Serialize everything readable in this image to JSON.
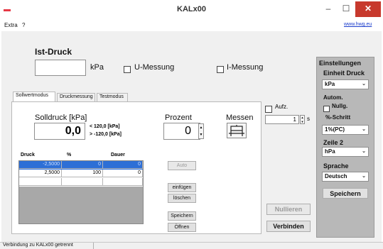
{
  "window": {
    "title": "KALx00",
    "min_glyph": "–",
    "max_glyph": "☐",
    "close_glyph": "✕"
  },
  "menu": {
    "items": [
      "Extra",
      "?"
    ],
    "link": "www.hwg.eu"
  },
  "ist_druck": {
    "title": "Ist-Druck",
    "value": "",
    "unit": "kPa",
    "u_messung": "U-Messung",
    "i_messung": "I-Messung"
  },
  "tabs": [
    "Sollwertmodus",
    "Druckmessung",
    "Testmodus"
  ],
  "solldruck": {
    "label": "Solldruck [kPa]",
    "value": "0,0",
    "max_label": "< 120,0 [kPa]",
    "min_label": "> -120,0 [kPa]"
  },
  "prozent": {
    "label": "Prozent",
    "value": "0"
  },
  "messen": {
    "label": "Messen"
  },
  "aufz": {
    "label": "Aufz.",
    "value": "1",
    "unit": "s"
  },
  "table": {
    "headers": [
      "Druck",
      "%",
      "Dauer"
    ],
    "rows": [
      [
        "-2,5000",
        "0",
        "0"
      ],
      [
        "2,5000",
        "100",
        "0"
      ],
      [
        "",
        "",
        ""
      ]
    ]
  },
  "buttons": {
    "auto": "Auto",
    "einfuegen": "einfügen",
    "loeschen": "löschen",
    "speichern": "Speichern",
    "oeffnen": "Öffnen",
    "nullieren": "Nullieren",
    "verbinden": "Verbinden"
  },
  "settings": {
    "title": "Einstellungen",
    "einheit_label": "Einheit Druck",
    "einheit_value": "kPa",
    "autom_label": "Autom.",
    "nullg_label": "Nullg.",
    "schritt_label": "%-Schritt",
    "schritt_value": "1%(PC)",
    "zeile_label": "Zeile 2",
    "zeile_value": "hPa",
    "sprache_label": "Sprache",
    "sprache_value": "Deutsch",
    "save": "Speichern"
  },
  "status": {
    "text": "Verbindung zu KALx00 getrennt"
  },
  "colors": {
    "close_button": "#c7392d",
    "selection": "#2d6fd6",
    "settings_panel": "#b8b8b8",
    "link": "#1a3ccc"
  }
}
